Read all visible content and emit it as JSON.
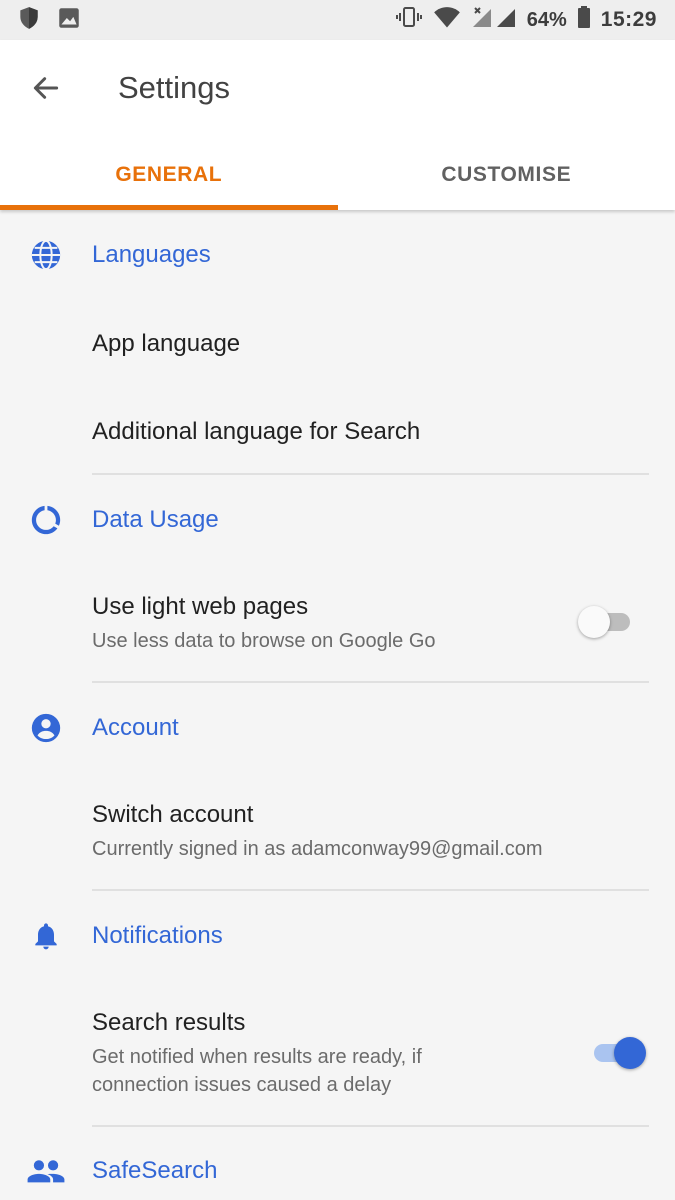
{
  "status_bar": {
    "battery_percent": "64%",
    "time": "15:29",
    "icons": [
      "shield-icon",
      "image-icon",
      "vibrate-icon",
      "wifi-icon",
      "signal-icon",
      "battery-icon"
    ]
  },
  "app_bar": {
    "title": "Settings",
    "back_icon": "arrow-back-icon",
    "tabs": [
      {
        "label": "GENERAL",
        "active": true
      },
      {
        "label": "CUSTOMISE",
        "active": false
      }
    ]
  },
  "colors": {
    "accent": "#e8710a",
    "section": "#3367d6",
    "switch_on": "#3367d6"
  },
  "sections": {
    "languages": {
      "label": "Languages",
      "icon": "globe-icon",
      "items": [
        {
          "primary": "App language"
        },
        {
          "primary": "Additional language for Search"
        }
      ]
    },
    "data_usage": {
      "label": "Data Usage",
      "icon": "data-usage-icon",
      "items": [
        {
          "primary": "Use light web pages",
          "secondary": "Use less data to browse on Google Go",
          "toggle": false
        }
      ]
    },
    "account": {
      "label": "Account",
      "icon": "account-circle-icon",
      "items": [
        {
          "primary": "Switch account",
          "secondary": "Currently signed in as adamconway99@gmail.com"
        }
      ]
    },
    "notifications": {
      "label": "Notifications",
      "icon": "bell-icon",
      "items": [
        {
          "primary": "Search results",
          "secondary_line1": "Get notified when results are ready, if",
          "secondary_line2": "connection issues caused a delay",
          "toggle": true
        }
      ]
    },
    "safesearch": {
      "label": "SafeSearch",
      "icon": "people-icon"
    }
  }
}
